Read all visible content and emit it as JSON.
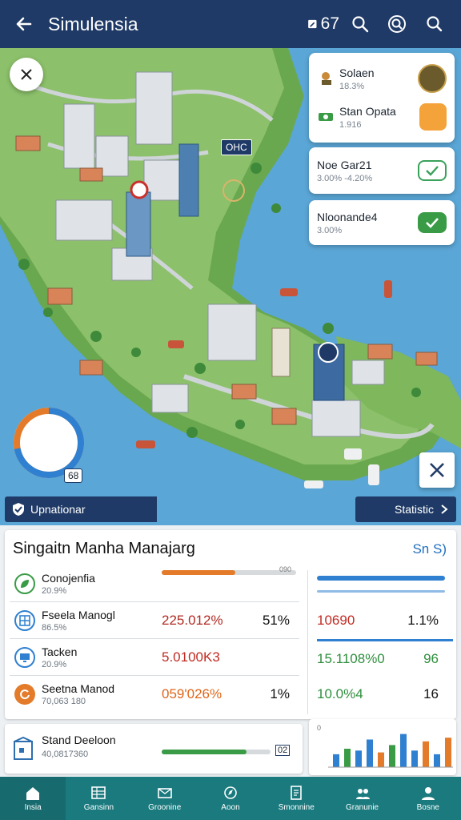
{
  "header": {
    "title": "Simulensia",
    "badge_label": "67",
    "icons": [
      "back-arrow-icon",
      "edit-badge-icon",
      "search-icon",
      "zoom-icon",
      "search-alt-icon"
    ]
  },
  "map": {
    "callout_label": "OHC",
    "donut_badge": "68",
    "donut_progress_percent": 72,
    "tab_left_label": "Upnationar",
    "tab_right_label": "Statistic",
    "panel_items": [
      {
        "name": "Solaen",
        "value": "18.3%"
      },
      {
        "name": "Stan Opata",
        "value": "1.916"
      }
    ],
    "panel_b": {
      "name": "Noe Gar21",
      "value": "3.00% -4.20%"
    },
    "panel_c": {
      "name": "Nloonande4",
      "value": "3.00%"
    }
  },
  "card": {
    "title": "Singaitn Manha Manajarg",
    "link": "Sn S)",
    "rows": [
      {
        "name": "Conojenfia",
        "sub": "20.9%",
        "value": "",
        "pct": "",
        "progress": 0.55,
        "progress_label": "090"
      },
      {
        "name": "Fseela Manogl",
        "sub": "86.5%",
        "value": "225.012%",
        "pct": "51%",
        "value_color": "#b22a22"
      },
      {
        "name": "Tacken",
        "sub": "20.9%",
        "value": "5.0100K3",
        "pct": "",
        "value_color": "#c22a22"
      },
      {
        "name": "Seetna Manod",
        "sub": "70,063 180",
        "value": "059'026%",
        "pct": "1%",
        "value_color": "#e0661a"
      }
    ],
    "right_rows": [
      {
        "value": "",
        "pct": ""
      },
      {
        "value": "10690",
        "pct": "1.1%",
        "value_color": "#c22a22"
      },
      {
        "value": "15.1108%0",
        "pct": "96",
        "value_color": "#2f8f3e"
      },
      {
        "value": "10.0%4",
        "pct": "16",
        "value_color": "#2f8f3e"
      }
    ]
  },
  "bottom_card": {
    "name": "Stand Deeloon",
    "sub": "40,0817360",
    "badge": "02",
    "progress": 0.78
  },
  "mini_chart": {
    "label": "0",
    "bars": [
      0.35,
      0.5,
      0.45,
      0.75,
      0.4,
      0.6,
      0.9,
      0.45,
      0.7,
      0.35,
      0.8
    ]
  },
  "nav": [
    {
      "label": "Insia",
      "icon": "home-icon"
    },
    {
      "label": "Gansinn",
      "icon": "grid-icon"
    },
    {
      "label": "Groonine",
      "icon": "mail-icon"
    },
    {
      "label": "Aoon",
      "icon": "compass-icon"
    },
    {
      "label": "Smonnine",
      "icon": "document-icon"
    },
    {
      "label": "Granunie",
      "icon": "group-icon"
    },
    {
      "label": "Bosne",
      "icon": "user-icon"
    }
  ],
  "colors": {
    "header": "#1f3a66",
    "nav": "#1a7a7e",
    "accent_orange": "#e37b2a",
    "accent_blue": "#2f80d0",
    "accent_green": "#3a9b46"
  }
}
